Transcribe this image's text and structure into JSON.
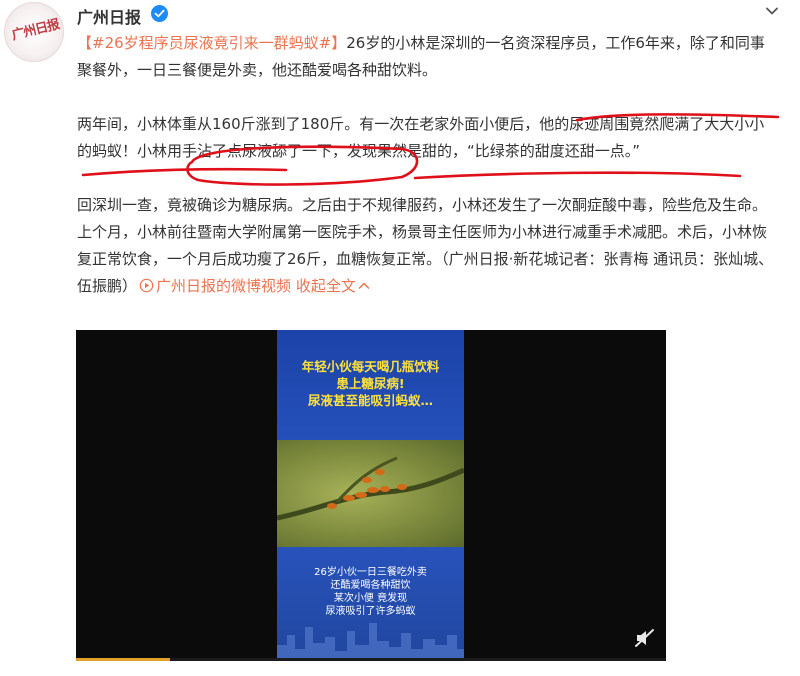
{
  "author": {
    "name": "广州日报",
    "avatar_text": "广州日报",
    "verified": true
  },
  "post": {
    "topic": "【#26岁程序员尿液竟引来一群蚂蚁#】",
    "p1_text": "26岁的小林是深圳的一名资深程序员，工作6年来，除了和同事聚餐外，一日三餐便是外卖，他还酷爱喝各种甜饮料。",
    "p2_a": "两年间，小林体重从160斤涨到了180斤。有一次在老家外面小便后，",
    "p2_b": "他的尿迹周围竟然爬满了大大小小的蚂蚁！",
    "p2_c": "小林用手沾了点尿液舔了一下，",
    "p2_d": "发现果然是甜的，“比绿茶的甜度还甜一点。”",
    "p3_text": "回深圳一查，竟被确诊为糖尿病。之后由于不规律服药，小林还发生了一次酮症酸中毒，险些危及生命。上个月，小林前往暨南大学附属第一医院手术，杨景哥主任医师为小林进行减重手术减肥。术后，小林恢复正常饮食，一个月后成功瘦了26斤，血糖恢复正常。（广州日报·新花城记者：张青梅 通讯员：张灿城、伍振鹏）",
    "video_link": "广州日报的微博视频",
    "collapse": "收起全文"
  },
  "video": {
    "headline": [
      "年轻小伙每天喝几瓶饮料",
      "患上糖尿病!",
      "尿液甚至能吸引蚂蚁…"
    ],
    "caption": [
      "26岁小伙一日三餐吃外卖",
      "还酷爱喝各种甜饮",
      "某次小便 竟发现",
      "尿液吸引了许多蚂蚁"
    ],
    "progress": 0.16
  },
  "colors": {
    "link": "#eb7350",
    "verified": "#1d8cf8",
    "annotation": "#e0101a",
    "poster_headline": "#ffe23a"
  },
  "icons": {
    "verified": "verified-check-icon",
    "more": "chevron-down-icon",
    "video_link": "play-circle-icon",
    "collapse": "chevron-up-icon",
    "mute": "mute-icon"
  }
}
